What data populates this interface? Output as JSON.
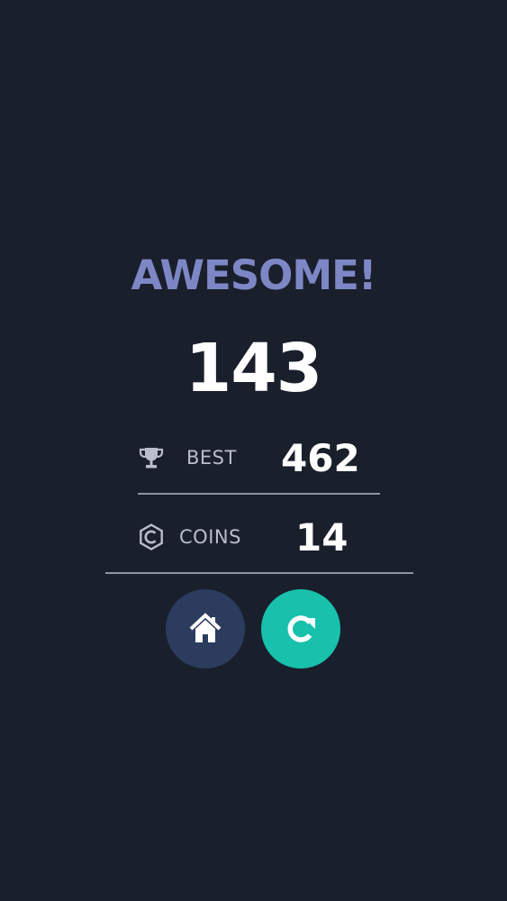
{
  "result": {
    "headline": "AWESOME!",
    "score": "143"
  },
  "stats": {
    "best": {
      "icon": "trophy-icon",
      "label": "BEST",
      "value": "462"
    },
    "coins": {
      "icon": "coin-icon",
      "label": "COINS",
      "value": "14"
    }
  },
  "actions": {
    "home": {
      "icon": "home-icon"
    },
    "replay": {
      "icon": "replay-icon"
    }
  },
  "colors": {
    "background": "#1a1f2c",
    "headline": "#7e87c6",
    "home_button": "#2b3c5e",
    "replay_button": "#17c1ac",
    "divider": "#8e93a6"
  }
}
